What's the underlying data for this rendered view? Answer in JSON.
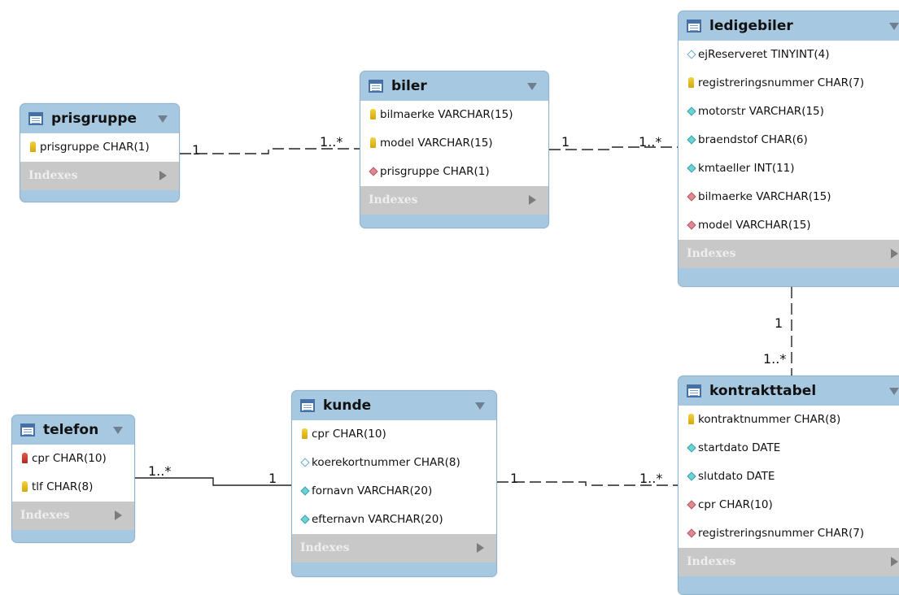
{
  "tables": [
    {
      "id": "prisgruppe",
      "name": "prisgruppe",
      "index_label": "Indexes",
      "columns": [
        {
          "text": "prisgruppe CHAR(1)",
          "icon": "primary-key-icon"
        }
      ]
    },
    {
      "id": "biler",
      "name": "biler",
      "index_label": "Indexes",
      "columns": [
        {
          "text": "bilmaerke VARCHAR(15)",
          "icon": "primary-key-icon"
        },
        {
          "text": "model VARCHAR(15)",
          "icon": "primary-key-icon"
        },
        {
          "text": "prisgruppe CHAR(1)",
          "icon": "foreign-key-diamond-icon"
        }
      ]
    },
    {
      "id": "ledigebiler",
      "name": "ledigebiler",
      "index_label": "Indexes",
      "columns": [
        {
          "text": "ejReserveret TINYINT(4)",
          "icon": "nullable-column-diamond-icon"
        },
        {
          "text": "registreringsnummer CHAR(7)",
          "icon": "primary-key-icon"
        },
        {
          "text": "motorstr VARCHAR(15)",
          "icon": "column-diamond-icon"
        },
        {
          "text": "braendstof CHAR(6)",
          "icon": "column-diamond-icon"
        },
        {
          "text": "kmtaeller INT(11)",
          "icon": "column-diamond-icon"
        },
        {
          "text": "bilmaerke VARCHAR(15)",
          "icon": "foreign-key-diamond-icon"
        },
        {
          "text": "model VARCHAR(15)",
          "icon": "foreign-key-diamond-icon"
        }
      ]
    },
    {
      "id": "telefon",
      "name": "telefon",
      "index_label": "Indexes",
      "columns": [
        {
          "text": "cpr CHAR(10)",
          "icon": "primary-foreign-key-icon"
        },
        {
          "text": "tlf CHAR(8)",
          "icon": "primary-key-icon"
        }
      ]
    },
    {
      "id": "kunde",
      "name": "kunde",
      "index_label": "Indexes",
      "columns": [
        {
          "text": "cpr CHAR(10)",
          "icon": "primary-key-icon"
        },
        {
          "text": "koerekortnummer CHAR(8)",
          "icon": "nullable-column-diamond-icon"
        },
        {
          "text": "fornavn VARCHAR(20)",
          "icon": "column-diamond-icon"
        },
        {
          "text": "efternavn VARCHAR(20)",
          "icon": "column-diamond-icon"
        }
      ]
    },
    {
      "id": "kontrakttabel",
      "name": "kontrakttabel",
      "index_label": "Indexes",
      "columns": [
        {
          "text": "kontraktnummer CHAR(8)",
          "icon": "primary-key-icon"
        },
        {
          "text": "startdato DATE",
          "icon": "column-diamond-icon"
        },
        {
          "text": "slutdato DATE",
          "icon": "column-diamond-icon"
        },
        {
          "text": "cpr CHAR(10)",
          "icon": "foreign-key-diamond-icon"
        },
        {
          "text": "registreringsnummer CHAR(7)",
          "icon": "foreign-key-diamond-icon"
        }
      ]
    }
  ],
  "relationships": [
    {
      "from": "prisgruppe",
      "to": "biler",
      "from_card": "1",
      "to_card": "1..*",
      "style": "dashed"
    },
    {
      "from": "biler",
      "to": "ledigebiler",
      "from_card": "1",
      "to_card": "1..*",
      "style": "dashed"
    },
    {
      "from": "ledigebiler",
      "to": "kontrakttabel",
      "from_card": "1",
      "to_card": "1..*",
      "style": "dashed"
    },
    {
      "from": "kunde",
      "to": "telefon",
      "from_card": "1",
      "to_card": "1..*",
      "style": "solid"
    },
    {
      "from": "kunde",
      "to": "kontrakttabel",
      "from_card": "1",
      "to_card": "1..*",
      "style": "dashed"
    }
  ],
  "colors": {
    "header": "#a6c8e0",
    "indexes_bar": "#c8c8c8",
    "table_icon": "#4571a8"
  }
}
